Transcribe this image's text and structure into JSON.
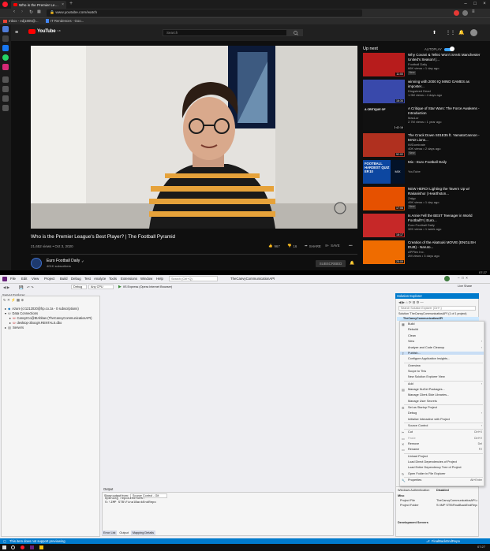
{
  "browser": {
    "tab_title": "Who is the Premier Leag...",
    "tab_close": "×",
    "url": "www.youtube.com/watch",
    "window_controls": [
      "–",
      "□",
      "×"
    ],
    "bookmarks": [
      "Inbox - edj1805@...",
      "IT Rendences - Goo..."
    ]
  },
  "youtube": {
    "logo": "YouTube",
    "logo_region": "GB",
    "search_placeholder": "Search",
    "video": {
      "title": "Who is the Premier League's Best Player? | The Football Pyramid",
      "meta": "21,652 views • Oct 3, 2020",
      "likes": "967",
      "dislikes": "16",
      "share": "SHARE",
      "save": "SAVE",
      "channel": "Euro Football Daily",
      "channel_verified": "✔",
      "subscribers": "401K subscribers",
      "subscribe_label": "SUBSCRIBED"
    },
    "upnext_label": "Up next",
    "autoplay_label": "AUTOPLAY",
    "recommendations": [
      {
        "title": "Why Covani & Tellez Won't SAVE Manchester United's Season! |...",
        "channel": "Football Daily",
        "views": "66K views • 1 day ago",
        "badge": "New",
        "duration": "11:00",
        "thumb_color": "#b71c1c"
      },
      {
        "title": "winning with 2000 IQ MIND GAMES as imposter...",
        "channel": "Dingsteed Dead",
        "views": "1.9M views • 4 days ago",
        "badge": "",
        "duration": "16:34",
        "thumb_color": "#3949ab"
      },
      {
        "title": "A Critique of Star Wars: The Force Awakens - Introduction",
        "channel": "MauLor",
        "views": "2.7M views • 1 year ago",
        "badge": "",
        "duration": "2:42:16",
        "thumb_color": "#111111"
      },
      {
        "title": "The Crack Down S01E35 ft. YamatoCannon - MAD Lions...",
        "channel": "IWDominate",
        "views": "40K views • 2 days ago",
        "badge": "New",
        "duration": "52:02",
        "thumb_color": "#b0301f"
      },
      {
        "title": "Mix - Euro Football Daily",
        "channel": "YouTube",
        "views": "",
        "badge": "",
        "duration": "",
        "thumb_color": "#0d47a1"
      },
      {
        "title": "NEW HERO! Lighting the Tavern Up w/ Rakanishu! | Hearthston...",
        "channel": "Zalyp",
        "views": "49K views • 1 day ago",
        "badge": "New",
        "duration": "17:06",
        "thumb_color": "#e65100"
      },
      {
        "title": "Is Arnie Fell the BEST Teenager in World Football?! | Euro...",
        "channel": "Euro Football Daily",
        "views": "32K views • 1 week ago",
        "badge": "",
        "duration": "18:17",
        "thumb_color": "#c62828"
      },
      {
        "title": "Creation of the Akatsuki MOVIE (ENGLISH DUB) - Naruto...",
        "channel": "APPlex Inc.",
        "views": "2M views • 3 days ago",
        "badge": "",
        "duration": "25:09",
        "thumb_color": "#ef6c00"
      }
    ],
    "mix_overlay": "MIX",
    "thumb_text": {
      "t3_line": "A CRITIQUE OF",
      "t5_line": "FOOTBALL HARDEST QUIZ EP.10"
    }
  },
  "vs": {
    "title": "TheCanvyCommunicationAPI",
    "menu": [
      "File",
      "Edit",
      "View",
      "Project",
      "Build",
      "Debug",
      "Test",
      "Analyze",
      "Tools",
      "Extensions",
      "Window",
      "Help"
    ],
    "search_placeholder": "Search (Ctrl+Q)",
    "project_label": "TheCanvyCommunicatiosAPI",
    "config": "Debug",
    "platform": "Any CPU",
    "run_target": "IIS Express (Opera Internet Browser)",
    "live_share": "Live Share",
    "server_explorer": {
      "title": "Server Explorer",
      "nodes": [
        "Azure (cr1212020@hp.co.za - 0 subscriptions)",
        "Data Connections",
        "CanvyICo@IEAbbas (TheCanvyCommunicatiosAPI)",
        "desktop-3bocg9.RENTALS.dbo",
        "Servers"
      ]
    },
    "output": {
      "title": "Output",
      "show_from_label": "Show output from:",
      "source": "Source Control - Git",
      "lines": [
        "Opening repositories:",
        "S:\\IMP STB\\FinalBackEndRepo"
      ],
      "tabs": [
        "Error List",
        "Output",
        "Mapping Details"
      ]
    },
    "solution_explorer": {
      "title": "Solution Explorer",
      "search": "Search Solution Explorer (Ctrl+;)",
      "solution_line": "Solution 'TheCanvyCommunicatiosAPI' (1 of 1 project)",
      "project": "TheCanvyCommunicatiosAPI"
    },
    "context_menu": [
      {
        "label": "Build",
        "key": ""
      },
      {
        "label": "Rebuild",
        "key": ""
      },
      {
        "label": "Clean",
        "key": ""
      },
      {
        "label": "View",
        "key": "›"
      },
      {
        "label": "Analyze and Code Cleanup",
        "key": "›"
      },
      {
        "label": "Publish...",
        "key": ""
      },
      {
        "label": "Configure Application Insights...",
        "key": ""
      },
      {
        "label": "Overview",
        "key": ""
      },
      {
        "label": "Scope to This",
        "key": ""
      },
      {
        "label": "New Solution Explorer View",
        "key": ""
      },
      {
        "label": "Add",
        "key": "›"
      },
      {
        "label": "Manage NuGet Packages...",
        "key": ""
      },
      {
        "label": "Manage Client-Side Libraries...",
        "key": ""
      },
      {
        "label": "Manage User Secrets",
        "key": ""
      },
      {
        "label": "Set as Startup Project",
        "key": ""
      },
      {
        "label": "Debug",
        "key": "›"
      },
      {
        "label": "Initialize Interactive with Project",
        "key": ""
      },
      {
        "label": "Source Control",
        "key": "›"
      },
      {
        "label": "Cut",
        "key": "Ctrl+X"
      },
      {
        "label": "Paste",
        "key": "Ctrl+V"
      },
      {
        "label": "Remove",
        "key": "Del"
      },
      {
        "label": "Rename",
        "key": "F2"
      },
      {
        "label": "Unload Project",
        "key": ""
      },
      {
        "label": "Load Direct Dependencies of Project",
        "key": ""
      },
      {
        "label": "Load Entire Dependency Tree of Project",
        "key": ""
      },
      {
        "label": "Open Folder in File Explorer",
        "key": ""
      },
      {
        "label": "Properties",
        "key": "Alt+Enter"
      }
    ],
    "properties": {
      "tabs": [
        "Windows Authentication",
        "Disabled"
      ],
      "section": "Misc",
      "rows": [
        {
          "name": "Project File",
          "value": "TheCanvyCommunicatiosAPI.csproj"
        },
        {
          "name": "Project Folder",
          "value": "S:\\IMP STB\\FinalBackEndRepo"
        }
      ],
      "footer": "Development Servers"
    },
    "status_left": "This item does not support previewing",
    "status_right": "FinalBackEndRepo",
    "clock": "07:27"
  }
}
